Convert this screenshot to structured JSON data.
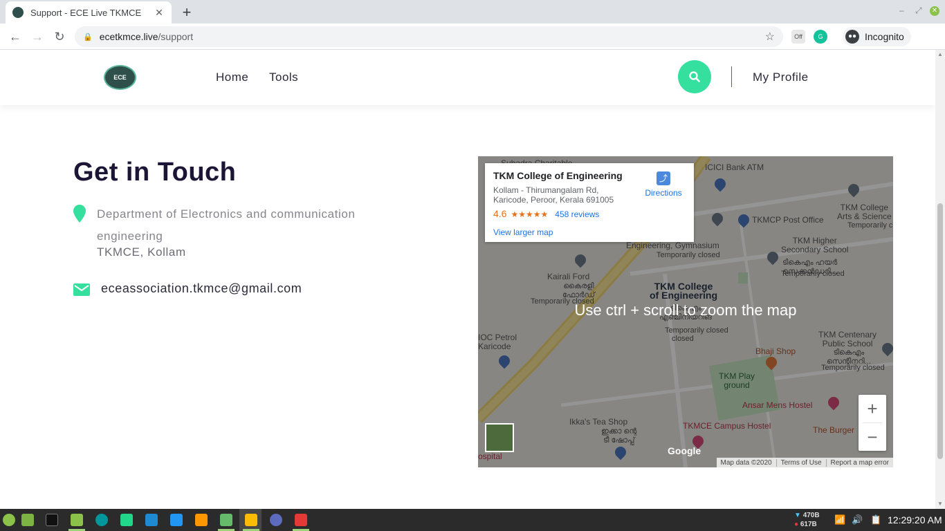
{
  "browser": {
    "tab_title": "Support - ECE Live TKMCE",
    "tab_close": "✕",
    "new_tab": "+",
    "url_host": "ecetkmce.live",
    "url_path": "/support",
    "incognito_label": "Incognito",
    "ext_off_label": "Off"
  },
  "site": {
    "logo_text": "ECE",
    "nav": [
      "Home",
      "Tools"
    ],
    "profile_label": "My Profile",
    "accent_color": "#35e09e"
  },
  "contact": {
    "heading": "Get in Touch",
    "address_line1": "Department of Electronics and communication engineering",
    "address_line2": "TKMCE, Kollam",
    "email": "eceassociation.tkmce@gmail.com"
  },
  "map": {
    "hint": "Use ctrl + scroll to zoom the map",
    "place_name": "TKM College of Engineering",
    "place_address": "Kollam - Thirumangalam Rd, Karicode, Peroor, Kerala 691005",
    "rating": "4.6",
    "stars": "★★★★★",
    "reviews": "458 reviews",
    "view_larger": "View larger map",
    "directions": "Directions",
    "zoom_in": "+",
    "zoom_out": "−",
    "google": "Google",
    "attribution": [
      "Map data ©2020",
      "Terms of Use",
      "Report a map error"
    ],
    "labels": {
      "icici": "ICICI Bank ATM",
      "tkm_arts": "TKM College\nArts & Science",
      "temp_closed": "Temporarily closed",
      "college_gym": "College of\nEngineering, Gymnasium",
      "post_office": "TKMCP Post Office",
      "higher_sec": "TKM Higher\nSecondary School",
      "higher_sec_ml": "ടികെഎം ഹയർ\nസെക്കൻഡറി...",
      "kairali": "Kairali Ford",
      "kairali_ml": "കൈരളി\nഫോർഡ്",
      "tkm_college": "TKM College\nof Engineering",
      "tkm_college_ml": "ടികെഎം\nഎഞ്ചിനീയറിങ്",
      "closed": "closed",
      "ioc": "IOC Petrol\nKaricode",
      "bhaji": "Bhaji Shop",
      "centenary": "TKM Centenary\nPublic School",
      "centenary_ml": "ടികെഎം\nസെന്റിനറി...",
      "play": "TKM Play\nground",
      "ansar": "Ansar Mens Hostel",
      "ikka": "Ikka's Tea Shop",
      "ikka_ml": "ഇക്കാ ന്റെ\nടീ ഷോപ്പ്",
      "hostel": "TKMCE Campus Hostel",
      "burger": "The Burger",
      "hospital": "ospital",
      "top_cut": "Subadra Charitable"
    }
  },
  "taskbar": {
    "net_up": "470B",
    "net_down": "617B",
    "clock": "12:29:20 AM"
  }
}
